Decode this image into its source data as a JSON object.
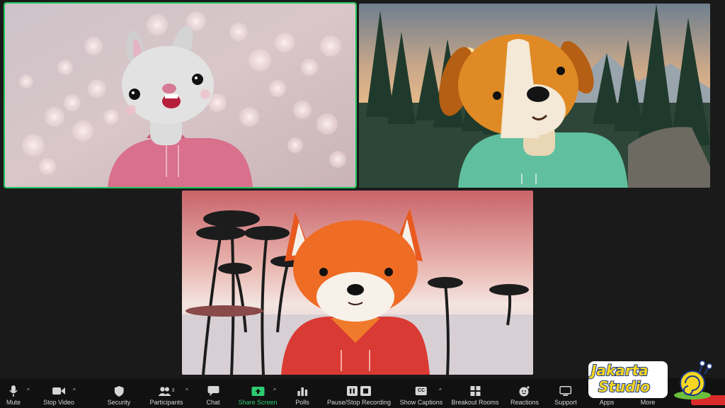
{
  "participants": [
    {
      "avatar": "bunny-avatar-icon",
      "background": "pink bokeh",
      "active_speaker": true
    },
    {
      "avatar": "dog-avatar-icon",
      "background": "mountain forest sunset",
      "active_speaker": false
    },
    {
      "avatar": "fox-avatar-icon",
      "background": "tropical palms sunset",
      "active_speaker": false
    }
  ],
  "toolbar": {
    "mute": "Mute",
    "stop_video": "Stop Video",
    "security": "Security",
    "participants": "Participants",
    "participants_count": "3",
    "chat": "Chat",
    "share_screen": "Share Screen",
    "polls": "Polls",
    "recording": "Pause/Stop Recording",
    "captions": "Show Captions",
    "captions_icon": "CC",
    "breakout": "Breakout Rooms",
    "reactions": "Reactions",
    "support": "Support",
    "apps": "Apps",
    "more": "More"
  },
  "watermark": {
    "line1": "Jakarta",
    "line2": "Studio"
  },
  "colors": {
    "active_speaker": "#22c55e",
    "share_accent": "#2ecc71",
    "toolbar_bg": "#111111"
  }
}
